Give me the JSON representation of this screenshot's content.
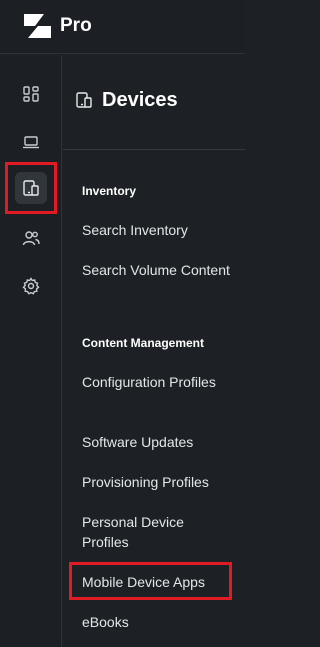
{
  "brand": {
    "name": "Pro"
  },
  "rail": {
    "items": [
      {
        "icon": "dashboard-icon"
      },
      {
        "icon": "laptop-icon"
      },
      {
        "icon": "devices-icon",
        "active": true
      },
      {
        "icon": "users-icon"
      },
      {
        "icon": "gear-icon"
      }
    ]
  },
  "panel": {
    "title": "Devices",
    "sections": [
      {
        "label": "Inventory",
        "items": [
          "Search Inventory",
          "Search Volume Content"
        ]
      },
      {
        "label": "Content Management",
        "items": [
          "Configuration Profiles",
          "Software Updates",
          "Provisioning Profiles",
          "Personal Device Profiles",
          "Mobile Device Apps",
          "eBooks"
        ]
      }
    ]
  },
  "colors": {
    "background": "#1d2125",
    "highlight": "#e01b24",
    "active_rail": "#31363c"
  }
}
